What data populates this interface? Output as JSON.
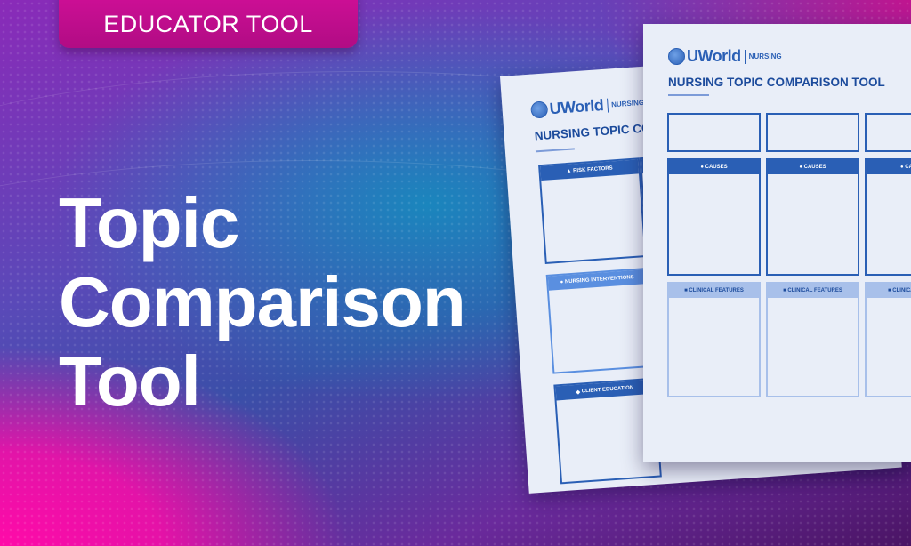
{
  "badge": {
    "label": "EDUCATOR TOOL"
  },
  "headline": {
    "line1": "Topic",
    "line2": "Comparison",
    "line3": "Tool"
  },
  "colors": {
    "badge": "#c10e8e",
    "accent_blue": "#2a5fb5",
    "title_navy": "#1c4b9c",
    "paper": "#e9eef8"
  },
  "back_sheet": {
    "logo_word": "UWorld",
    "logo_sub": "NURSING",
    "title": "NURSING TOPIC CO",
    "sections": [
      {
        "icon": "▲",
        "label": "RISK FACTORS"
      },
      {
        "icon": "●",
        "label": "NURSING INTERVENTIONS"
      },
      {
        "icon": "◆",
        "label": "CLIENT EDUCATION"
      }
    ]
  },
  "front_sheet": {
    "logo_word": "UWorld",
    "logo_sub": "NURSING",
    "title": "NURSING TOPIC COMPARISON TOOL",
    "causes_label": "● CAUSES",
    "causes_label_cut": "● CA",
    "clinical_label": "■ CLINICAL FEATURES",
    "clinical_label_cut": "■ CLINICAL"
  }
}
